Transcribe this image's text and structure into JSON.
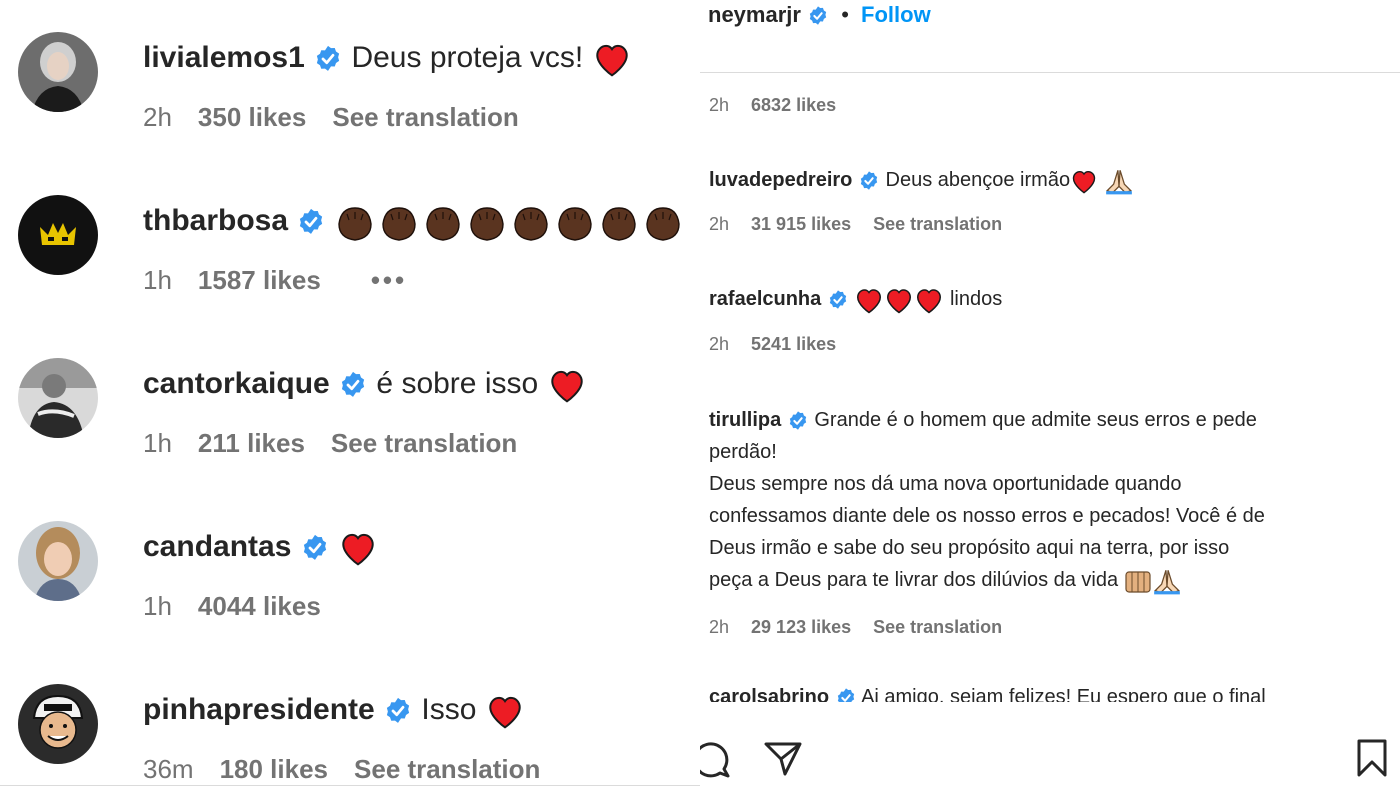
{
  "left_panel": {
    "comments": [
      {
        "username": "livialemos1",
        "text": "Deus proteja vcs!",
        "time": "2h",
        "likes": "350 likes",
        "translate": "See translation"
      },
      {
        "username": "thbarbosa",
        "text": "",
        "time": "1h",
        "likes": "1587 likes",
        "more": "•••"
      },
      {
        "username": "cantorkaique",
        "text": "é sobre isso",
        "time": "1h",
        "likes": "211 likes",
        "translate": "See translation"
      },
      {
        "username": "candantas",
        "text": "",
        "time": "1h",
        "likes": "4044 likes"
      },
      {
        "username": "pinhapresidente",
        "text": "Isso",
        "time": "36m",
        "likes": "180 likes",
        "translate": "See translation"
      }
    ]
  },
  "right_panel": {
    "header": {
      "owner": "neymarjr",
      "separator": "•",
      "follow": "Follow"
    },
    "top_meta": {
      "time": "2h",
      "likes": "6832 likes"
    },
    "comments": [
      {
        "username": "luvadepedreiro",
        "text": "Deus abençoe irmão",
        "time": "2h",
        "likes": "31 915 likes",
        "translate": "See translation"
      },
      {
        "username": "rafaelcunha",
        "text": "lindos",
        "time": "2h",
        "likes": "5241 likes"
      },
      {
        "username": "tirullipa",
        "lines": [
          "Grande é o homem que admite seus erros e pede",
          "perdão!",
          "Deus sempre nos dá uma nova oportunidade quando",
          "confessamos diante dele os nosso erros e pecados! Você é de",
          "Deus irmão e sabe do seu propósito aqui na terra, por isso",
          "peça a Deus para te livrar dos dilúvios da vida"
        ],
        "time": "2h",
        "likes": "29 123 likes",
        "translate": "See translation"
      }
    ],
    "partial_comment": {
      "username": "carolsabrino",
      "text": "Ai amigo, sejam felizes! Eu espero que o final"
    }
  },
  "icons": {
    "verified": "verified-badge-icon",
    "heart": "red-heart-emoji",
    "praying": "praying-hands-emoji",
    "clapping": "clapping-hands-emoji",
    "comment": "comment-icon",
    "share": "share-icon",
    "save": "bookmark-icon"
  },
  "colors": {
    "verified_blue": "#3897f0",
    "follow_blue": "#0095f6",
    "heart_red": "#ed1c24",
    "meta_gray": "#737373"
  }
}
